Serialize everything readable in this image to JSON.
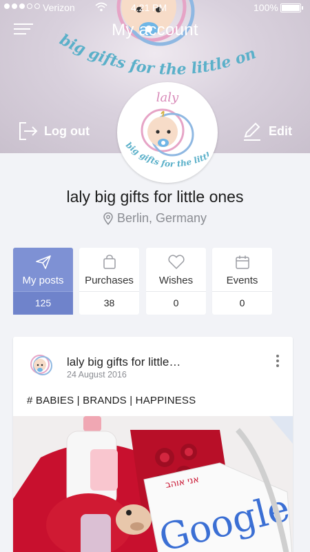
{
  "status_bar": {
    "carrier": "Verizon",
    "time": "4:21 PM",
    "battery": "100%"
  },
  "header": {
    "title": "My account",
    "slogan": "big gifts for the little ones",
    "logout_label": "Log out",
    "edit_label": "Edit"
  },
  "avatar": {
    "brand": "laly",
    "slogan": "big gifts for the little ones"
  },
  "profile": {
    "name": "laly big gifts for little ones",
    "location": "Berlin, Germany"
  },
  "stats": [
    {
      "label": "My posts",
      "count": "125",
      "icon": "paper-plane-icon",
      "active": true
    },
    {
      "label": "Purchases",
      "count": "38",
      "icon": "shopping-bag-icon",
      "active": false
    },
    {
      "label": "Wishes",
      "count": "0",
      "icon": "heart-icon",
      "active": false
    },
    {
      "label": "Events",
      "count": "0",
      "icon": "calendar-icon",
      "active": false
    }
  ],
  "post": {
    "author": "laly big gifts for little…",
    "date": "24 August 2016",
    "tags": "# BABIES | BRANDS | HAPPINESS",
    "image_text": "Google"
  },
  "colors": {
    "accent": "#7e91d4",
    "accent_dark": "#6f83cb",
    "background": "#f2f3f7",
    "muted_text": "#8a8c92"
  }
}
